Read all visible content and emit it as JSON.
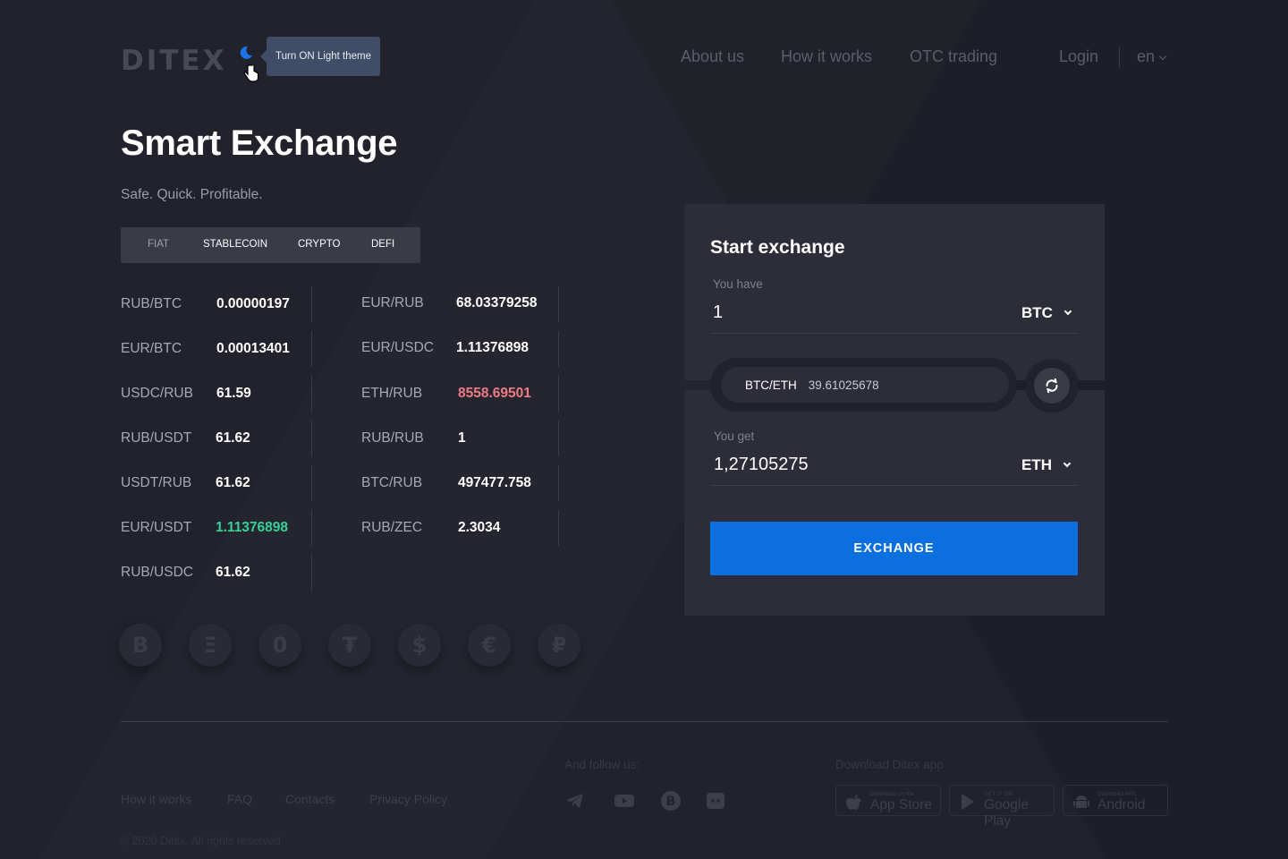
{
  "header": {
    "logo": "DITEX",
    "tooltip": "Turn ON Light theme",
    "nav": [
      "About us",
      "How it works",
      "OTC trading"
    ],
    "login": "Login",
    "lang": "en"
  },
  "hero": {
    "title": "Smart Exchange",
    "subtitle": "Safe. Quick. Profitable."
  },
  "tabs": [
    "FIAT",
    "STABLECOIN",
    "CRYPTO",
    "DEFI"
  ],
  "rates_left": [
    {
      "pair": "RUB/BTC",
      "value": "0.00000197"
    },
    {
      "pair": "EUR/BTC",
      "value": "0.00013401"
    },
    {
      "pair": "USDC/RUB",
      "value": "61.59"
    },
    {
      "pair": "RUB/USDT",
      "value": "61.62"
    },
    {
      "pair": "USDT/RUB",
      "value": "61.62"
    },
    {
      "pair": "EUR/USDT",
      "value": "1.11376898"
    },
    {
      "pair": "RUB/USDC",
      "value": "61.62"
    }
  ],
  "rates_right": [
    {
      "pair": "EUR/RUB",
      "value": "68.03379258"
    },
    {
      "pair": "EUR/USDC",
      "value": "1.11376898"
    },
    {
      "pair": "ETH/RUB",
      "value": "8558.69501"
    },
    {
      "pair": "RUB/RUB",
      "value": "1"
    },
    {
      "pair": "BTC/RUB",
      "value": "497477.758"
    },
    {
      "pair": "RUB/ZEC",
      "value": "2.3034"
    }
  ],
  "coins": [
    "B",
    "Ξ",
    "0",
    "₮",
    "$",
    "€",
    "₽"
  ],
  "exchange": {
    "title": "Start exchange",
    "have_label": "You have",
    "have_value": "1",
    "have_currency": "BTC",
    "rate_pair": "BTC/ETH",
    "rate_value": "39.61025678",
    "get_label": "You get",
    "get_value": "1,27105275",
    "get_currency": "ETH",
    "button": "EXCHANGE"
  },
  "footer": {
    "links": [
      "How it works",
      "FAQ",
      "Contacts",
      "Privacy Policy"
    ],
    "follow_label": "And follow us:",
    "download_label": "Download Ditex app",
    "stores": [
      {
        "small": "Download on the",
        "big": "App Store"
      },
      {
        "small": "GET IT ON",
        "big": "Google Play"
      },
      {
        "small": "Download APK",
        "big": "Android"
      }
    ],
    "copyright": "© 2020 Ditex. All rights reserved"
  },
  "colors": {
    "background": "#21222c",
    "card": "#2c2d38",
    "accent": "#0b6fe0",
    "positive": "#37d19a",
    "negative": "#f07b87"
  }
}
